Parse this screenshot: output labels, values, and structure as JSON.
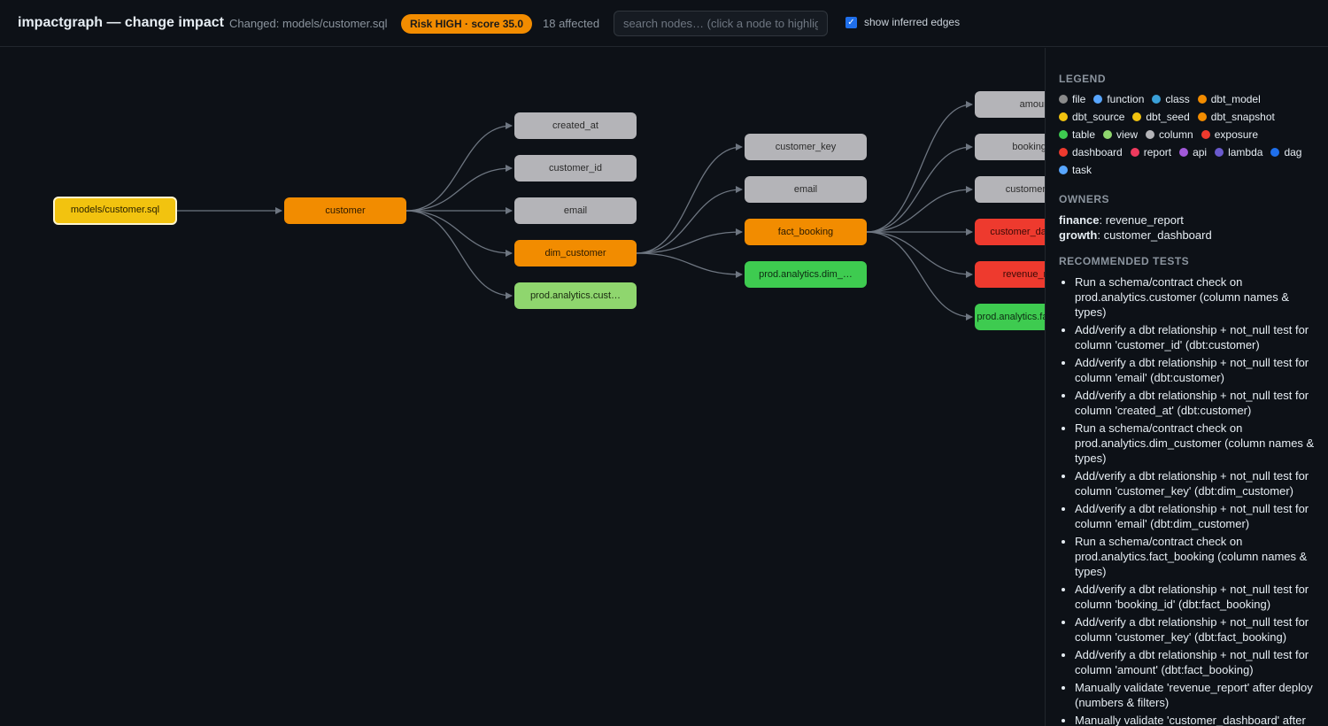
{
  "header": {
    "title": "impactgraph — change impact",
    "changed": "Changed: models/customer.sql",
    "risk": "Risk HIGH · score 35.0",
    "affected": "18 affected",
    "search_placeholder": "search nodes… (click a node to highlight)",
    "inferred_label": "show inferred edges",
    "inferred_checked": true
  },
  "colors": {
    "risk": "#f28c00",
    "file": "#9e9e9e",
    "changed_node": "#f2c30f",
    "dbt_model": "#f28c00",
    "column": "#b4b4b8",
    "table": "#3ecb50",
    "view": "#8fd66e",
    "dashboard": "#ee3a2e"
  },
  "graph": {
    "nodes": [
      {
        "id": "models/customer.sql",
        "label": "models/customer.sql",
        "kind": "file_changed"
      },
      {
        "id": "customer",
        "label": "customer",
        "kind": "dbt_model"
      },
      {
        "id": "created_at",
        "label": "created_at",
        "kind": "column"
      },
      {
        "id": "customer_id",
        "label": "customer_id",
        "kind": "column"
      },
      {
        "id": "email_1",
        "label": "email",
        "kind": "column"
      },
      {
        "id": "dim_customer",
        "label": "dim_customer",
        "kind": "dbt_model"
      },
      {
        "id": "prod.analytics.customer",
        "label": "prod.analytics.cust…",
        "kind": "view"
      },
      {
        "id": "customer_key",
        "label": "customer_key",
        "kind": "column"
      },
      {
        "id": "email_2",
        "label": "email",
        "kind": "column"
      },
      {
        "id": "fact_booking",
        "label": "fact_booking",
        "kind": "dbt_model"
      },
      {
        "id": "prod.analytics.dim_customer",
        "label": "prod.analytics.dim_…",
        "kind": "table"
      },
      {
        "id": "amount",
        "label": "amount",
        "kind": "column"
      },
      {
        "id": "booking_id",
        "label": "booking_id",
        "kind": "column"
      },
      {
        "id": "customer_key_2",
        "label": "customer_key",
        "kind": "column"
      },
      {
        "id": "customer_dashboard",
        "label": "customer_dashboard",
        "kind": "dashboard"
      },
      {
        "id": "revenue_report",
        "label": "revenue_report",
        "kind": "report"
      },
      {
        "id": "prod.analytics.fact_booking",
        "label": "prod.analytics.fact_booking",
        "kind": "table"
      }
    ]
  },
  "legend": {
    "title": "LEGEND",
    "items": [
      {
        "label": "file",
        "color": "#8b8b8b"
      },
      {
        "label": "function",
        "color": "#58a6ff"
      },
      {
        "label": "class",
        "color": "#3aa0d8"
      },
      {
        "label": "dbt_model",
        "color": "#f28c00"
      },
      {
        "label": "dbt_source",
        "color": "#f2c30f"
      },
      {
        "label": "dbt_seed",
        "color": "#f2c30f"
      },
      {
        "label": "dbt_snapshot",
        "color": "#f28c00"
      },
      {
        "label": "table",
        "color": "#3ecb50"
      },
      {
        "label": "view",
        "color": "#8fd66e"
      },
      {
        "label": "column",
        "color": "#b4b4b8"
      },
      {
        "label": "exposure",
        "color": "#ee3a2e"
      },
      {
        "label": "dashboard",
        "color": "#ee3a2e"
      },
      {
        "label": "report",
        "color": "#ee3a5e"
      },
      {
        "label": "api",
        "color": "#a259d9"
      },
      {
        "label": "lambda",
        "color": "#6a5acd"
      },
      {
        "label": "dag",
        "color": "#1f6feb"
      },
      {
        "label": "task",
        "color": "#58a6ff"
      }
    ]
  },
  "owners": {
    "title": "OWNERS",
    "rows": [
      {
        "team": "finance",
        "asset": "revenue_report"
      },
      {
        "team": "growth",
        "asset": "customer_dashboard"
      }
    ]
  },
  "tests": {
    "title": "RECOMMENDED TESTS",
    "items": [
      "Run a schema/contract check on prod.analytics.customer (column names & types)",
      "Add/verify a dbt relationship + not_null test for column 'customer_id' (dbt:customer)",
      "Add/verify a dbt relationship + not_null test for column 'email' (dbt:customer)",
      "Add/verify a dbt relationship + not_null test for column 'created_at' (dbt:customer)",
      "Run a schema/contract check on prod.analytics.dim_customer (column names & types)",
      "Add/verify a dbt relationship + not_null test for column 'customer_key' (dbt:dim_customer)",
      "Add/verify a dbt relationship + not_null test for column 'email' (dbt:dim_customer)",
      "Run a schema/contract check on prod.analytics.fact_booking (column names & types)",
      "Add/verify a dbt relationship + not_null test for column 'booking_id' (dbt:fact_booking)",
      "Add/verify a dbt relationship + not_null test for column 'customer_key' (dbt:fact_booking)",
      "Add/verify a dbt relationship + not_null test for column 'amount' (dbt:fact_booking)",
      "Manually validate 'revenue_report' after deploy (numbers & filters)",
      "Manually validate 'customer_dashboard' after deploy (numbers & filters)"
    ]
  }
}
